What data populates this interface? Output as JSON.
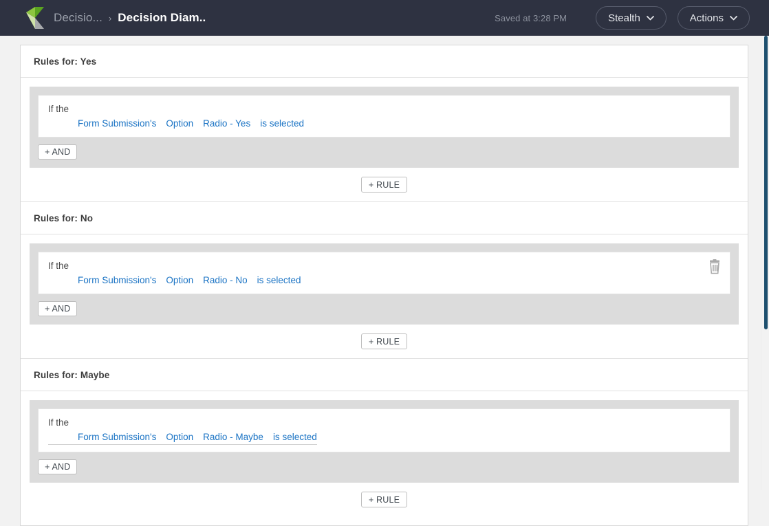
{
  "topbar": {
    "logo_icon": "decisions-arrow-logo",
    "breadcrumb": {
      "parent": "Decisio...",
      "separator": "›",
      "current": "Decision Diam.."
    },
    "saved_status": "Saved at 3:28 PM",
    "buttons": [
      {
        "label": "Stealth",
        "icon": "chevron-down-icon"
      },
      {
        "label": "Actions",
        "icon": "chevron-down-icon"
      }
    ],
    "colors": {
      "background": "#2e3241",
      "muted_text": "#9ba0ab",
      "active_text": "#ffffff"
    }
  },
  "colors": {
    "page_background": "#f2f2f2",
    "panel_background": "#ffffff",
    "rule_block_background": "#dcdcdc",
    "link_blue": "#1a73c4",
    "scrollbar_thumb": "#1d4f6e"
  },
  "sections": [
    {
      "title": "Rules for: Yes",
      "has_delete": false,
      "underlined": false,
      "rule": {
        "if_label": "If the",
        "condition": [
          "Form Submission's",
          "Option",
          "Radio - Yes",
          "is selected"
        ],
        "and_label": "+ AND"
      },
      "add_rule_label": "+ RULE"
    },
    {
      "title": "Rules for: No",
      "has_delete": true,
      "underlined": false,
      "delete_icon": "trash-icon",
      "rule": {
        "if_label": "If the",
        "condition": [
          "Form Submission's",
          "Option",
          "Radio - No",
          "is selected"
        ],
        "and_label": "+ AND"
      },
      "add_rule_label": "+ RULE"
    },
    {
      "title": "Rules for: Maybe",
      "has_delete": false,
      "underlined": true,
      "rule": {
        "if_label": "If the",
        "condition": [
          "Form Submission's",
          "Option",
          "Radio - Maybe",
          "is selected"
        ],
        "and_label": "+ AND"
      },
      "add_rule_label": "+ RULE"
    }
  ]
}
